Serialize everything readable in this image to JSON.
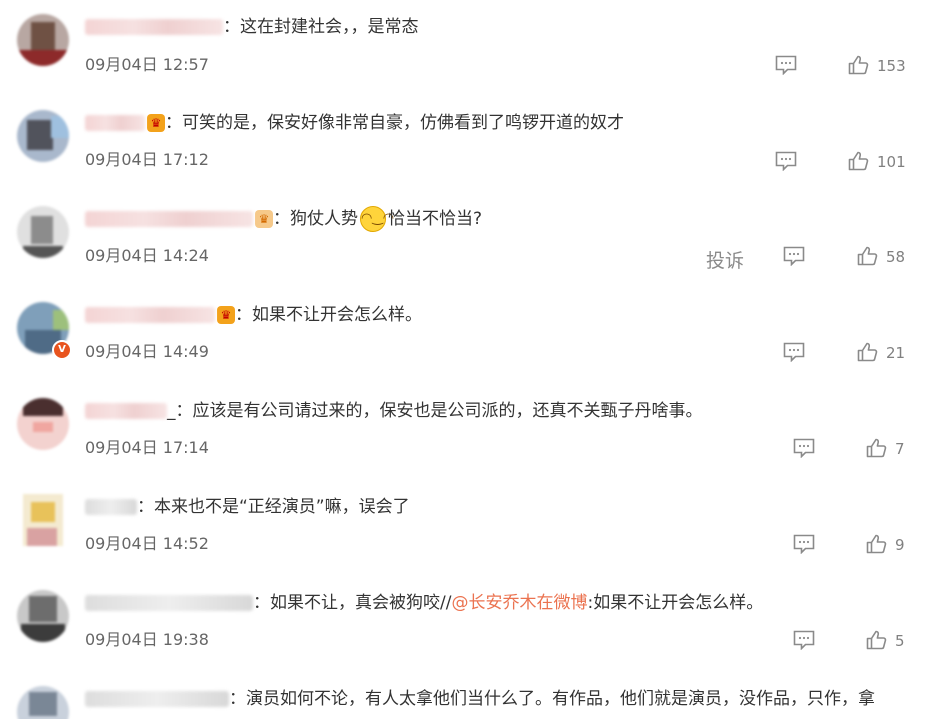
{
  "comments": [
    {
      "text": "：这在封建社会，，是常态",
      "time": "09月04日 12:57",
      "likes": "153"
    },
    {
      "text": "：可笑的是，保安好像非常自豪，仿佛看到了鸣锣开道的奴才",
      "time": "09月04日 17:12",
      "likes": "101"
    },
    {
      "text_before": "：狗仗人势",
      "text_after": "恰当不恰当?",
      "time": "09月04日 14:24",
      "likes": "58",
      "report_label": "投诉"
    },
    {
      "text": "：如果不让开会怎么样。",
      "time": "09月04日 14:49",
      "likes": "21"
    },
    {
      "text": "_：应该是有公司请过来的，保安也是公司派的，还真不关甄子丹啥事。",
      "time": "09月04日 17:14",
      "likes": "7"
    },
    {
      "text": "：本来也不是“正经演员”嘛，误会了",
      "time": "09月04日 14:52",
      "likes": "9"
    },
    {
      "text_before": "：如果不让，真会被狗咬//",
      "mention": "@长安乔木在微博",
      "text_after": ":如果不让开会怎么样。",
      "time": "09月04日 19:38",
      "likes": "5"
    },
    {
      "text": "：演员如何不论，有人太拿他们当什么了。有作品，他们就是演员，没作品，只作，拿"
    }
  ],
  "icons": {
    "reply": "comment-icon",
    "like": "thumbs-up-icon",
    "verified": "verified-v-icon",
    "vip": "vip-crown-icon"
  },
  "colors": {
    "mention": "#eb7350",
    "icon": "#8a8a8a",
    "time": "#666666"
  }
}
